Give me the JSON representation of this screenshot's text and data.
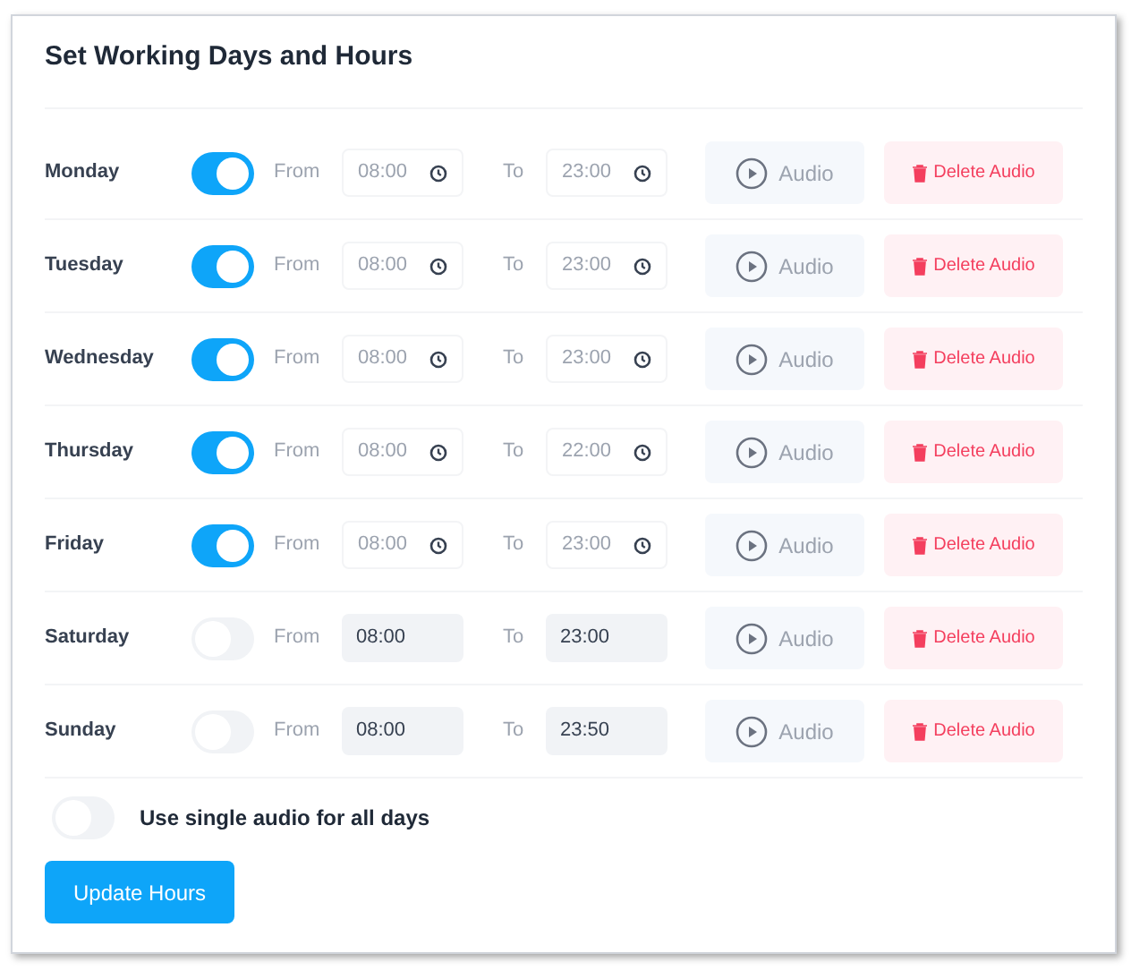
{
  "title": "Set Working Days and Hours",
  "days": [
    {
      "day": "Monday",
      "on": true,
      "from_label": "From",
      "from": "08:00",
      "to_label": "To",
      "to": "23:00",
      "audio": "Audio",
      "delete": "Delete Audio"
    },
    {
      "day": "Tuesday",
      "on": true,
      "from_label": "From",
      "from": "08:00",
      "to_label": "To",
      "to": "23:00",
      "audio": "Audio",
      "delete": "Delete Audio"
    },
    {
      "day": "Wednesday",
      "on": true,
      "from_label": "From",
      "from": "08:00",
      "to_label": "To",
      "to": "23:00",
      "audio": "Audio",
      "delete": "Delete Audio"
    },
    {
      "day": "Thursday",
      "on": true,
      "from_label": "From",
      "from": "08:00",
      "to_label": "To",
      "to": "22:00",
      "audio": "Audio",
      "delete": "Delete Audio"
    },
    {
      "day": "Friday",
      "on": true,
      "from_label": "From",
      "from": "08:00",
      "to_label": "To",
      "to": "23:00",
      "audio": "Audio",
      "delete": "Delete Audio"
    },
    {
      "day": "Saturday",
      "on": false,
      "from_label": "From",
      "from": "08:00",
      "to_label": "To",
      "to": "23:00",
      "audio": "Audio",
      "delete": "Delete Audio"
    },
    {
      "day": "Sunday",
      "on": false,
      "from_label": "From",
      "from": "08:00",
      "to_label": "To",
      "to": "23:50",
      "audio": "Audio",
      "delete": "Delete Audio"
    }
  ],
  "single_audio": {
    "label": "Use single audio for all days",
    "on": false
  },
  "submit": "Update Hours"
}
